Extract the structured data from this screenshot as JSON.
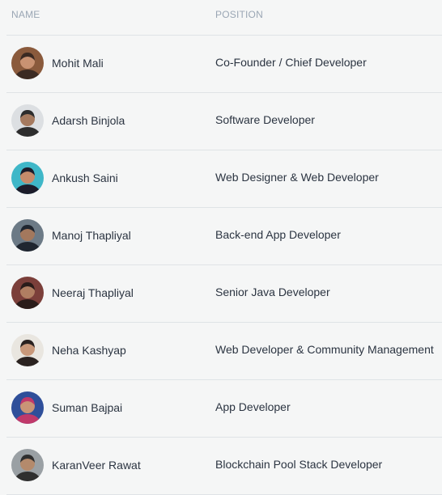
{
  "table": {
    "headers": {
      "name": "NAME",
      "position": "POSITION"
    },
    "members": [
      {
        "name": "Mohit Mali",
        "position": "Co-Founder / Chief Developer",
        "avatar_bg": "#8a5a3c",
        "avatar_fg": "#3b2a22",
        "avatar_skin": "#c99272"
      },
      {
        "name": "Adarsh Binjola",
        "position": "Software Developer",
        "avatar_bg": "#dcdfe2",
        "avatar_fg": "#2d2d2d",
        "avatar_skin": "#a57a5f"
      },
      {
        "name": "Ankush Saini",
        "position": "Web Designer & Web Developer",
        "avatar_bg": "#3fb7c8",
        "avatar_fg": "#1c1c2a",
        "avatar_skin": "#c58b6b"
      },
      {
        "name": "Manoj Thapliyal",
        "position": "Back-end App Developer",
        "avatar_bg": "#6c7a86",
        "avatar_fg": "#1f2630",
        "avatar_skin": "#a3785d"
      },
      {
        "name": "Neeraj Thapliyal",
        "position": "Senior Java Developer",
        "avatar_bg": "#7b3f3a",
        "avatar_fg": "#2a1c1a",
        "avatar_skin": "#b07e62"
      },
      {
        "name": "Neha Kashyap",
        "position": "Web Developer & Community Management",
        "avatar_bg": "#e9e6e0",
        "avatar_fg": "#2a2220",
        "avatar_skin": "#c8987a"
      },
      {
        "name": "Suman Bajpai",
        "position": "App Developer",
        "avatar_bg": "#2f4f9a",
        "avatar_fg": "#c0396a",
        "avatar_skin": "#c99476"
      },
      {
        "name": "KaranVeer Rawat",
        "position": "Blockchain Pool Stack Developer",
        "avatar_bg": "#9aa0a4",
        "avatar_fg": "#2f2f2f",
        "avatar_skin": "#b48a6c"
      }
    ]
  }
}
